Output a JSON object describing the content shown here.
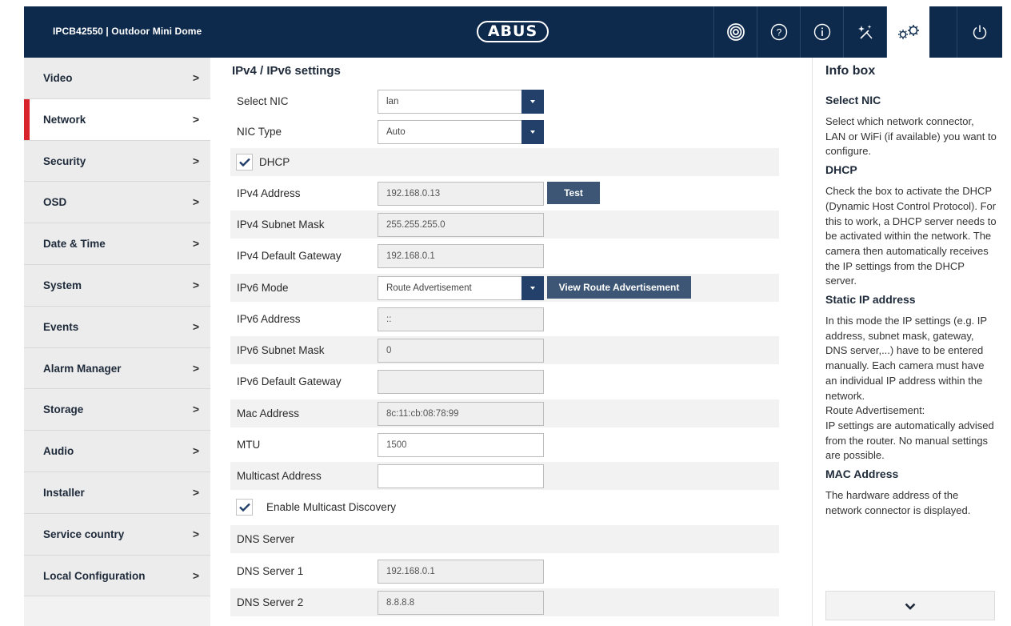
{
  "header": {
    "device_title": "IPCB42550  |  Outdoor Mini Dome",
    "logo_text": "ABUS",
    "buttons": [
      "live-view",
      "help",
      "info",
      "wizard",
      "settings",
      "power"
    ]
  },
  "sidebar": {
    "items": [
      {
        "label": "Video",
        "active": false
      },
      {
        "label": "Network",
        "active": true
      },
      {
        "label": "Security",
        "active": false
      },
      {
        "label": "OSD",
        "active": false
      },
      {
        "label": "Date & Time",
        "active": false
      },
      {
        "label": "System",
        "active": false
      },
      {
        "label": "Events",
        "active": false
      },
      {
        "label": "Alarm Manager",
        "active": false
      },
      {
        "label": "Storage",
        "active": false
      },
      {
        "label": "Audio",
        "active": false
      },
      {
        "label": "Installer",
        "active": false
      },
      {
        "label": "Service country",
        "active": false
      },
      {
        "label": "Local Configuration",
        "active": false
      }
    ],
    "chevron": ">"
  },
  "main": {
    "title": "IPv4 / IPv6 settings",
    "select_nic": {
      "label": "Select NIC",
      "value": "lan"
    },
    "nic_type": {
      "label": "NIC Type",
      "value": "Auto"
    },
    "dhcp": {
      "label": "DHCP",
      "checked": true
    },
    "ipv4_address": {
      "label": "IPv4 Address",
      "value": "192.168.0.13"
    },
    "test_button": "Test",
    "ipv4_subnet": {
      "label": "IPv4 Subnet Mask",
      "value": "255.255.255.0"
    },
    "ipv4_gateway": {
      "label": "IPv4 Default Gateway",
      "value": "192.168.0.1"
    },
    "ipv6_mode": {
      "label": "IPv6 Mode",
      "value": "Route Advertisement"
    },
    "view_route_button": "View Route Advertisement",
    "ipv6_address": {
      "label": "IPv6 Address",
      "value": "::"
    },
    "ipv6_subnet": {
      "label": "IPv6 Subnet Mask",
      "value": "0"
    },
    "ipv6_gateway": {
      "label": "IPv6 Default Gateway",
      "value": ""
    },
    "mac_address": {
      "label": "Mac Address",
      "value": "8c:11:cb:08:78:99"
    },
    "mtu": {
      "label": "MTU",
      "value": "1500"
    },
    "multicast": {
      "label": "Multicast Address",
      "value": ""
    },
    "multicast_discovery": {
      "label": "Enable Multicast Discovery",
      "checked": true
    },
    "dns_header": "DNS Server",
    "dns1": {
      "label": "DNS Server 1",
      "value": "192.168.0.1"
    },
    "dns2": {
      "label": "DNS Server 2",
      "value": "8.8.8.8"
    }
  },
  "infobox": {
    "title": "Info box",
    "sections": [
      {
        "heading": "Select NIC",
        "text": "Select which network connector, LAN or WiFi (if available) you want to configure."
      },
      {
        "heading": "DHCP",
        "text": "Check the box to activate the DHCP (Dynamic Host Control Protocol). For this to work, a DHCP server needs to be activated within the network. The camera then automatically receives the IP settings from the DHCP server."
      },
      {
        "heading": "Static IP address",
        "text": "In this mode the IP settings (e.g. IP address, subnet mask, gateway, DNS server,...) have to be entered manually. Each camera must have an individual IP address within the network.",
        "text2": "Route Advertisement:",
        "text3": "IP settings are automatically advised from the router. No manual settings are possible."
      },
      {
        "heading": "MAC Address",
        "text": "The hardware address of the network connector is displayed."
      }
    ]
  },
  "colors": {
    "topbar": "#0d2a4d",
    "accent_red": "#d8232a",
    "button_blue": "#3d5675",
    "select_arrow": "#22406a"
  }
}
